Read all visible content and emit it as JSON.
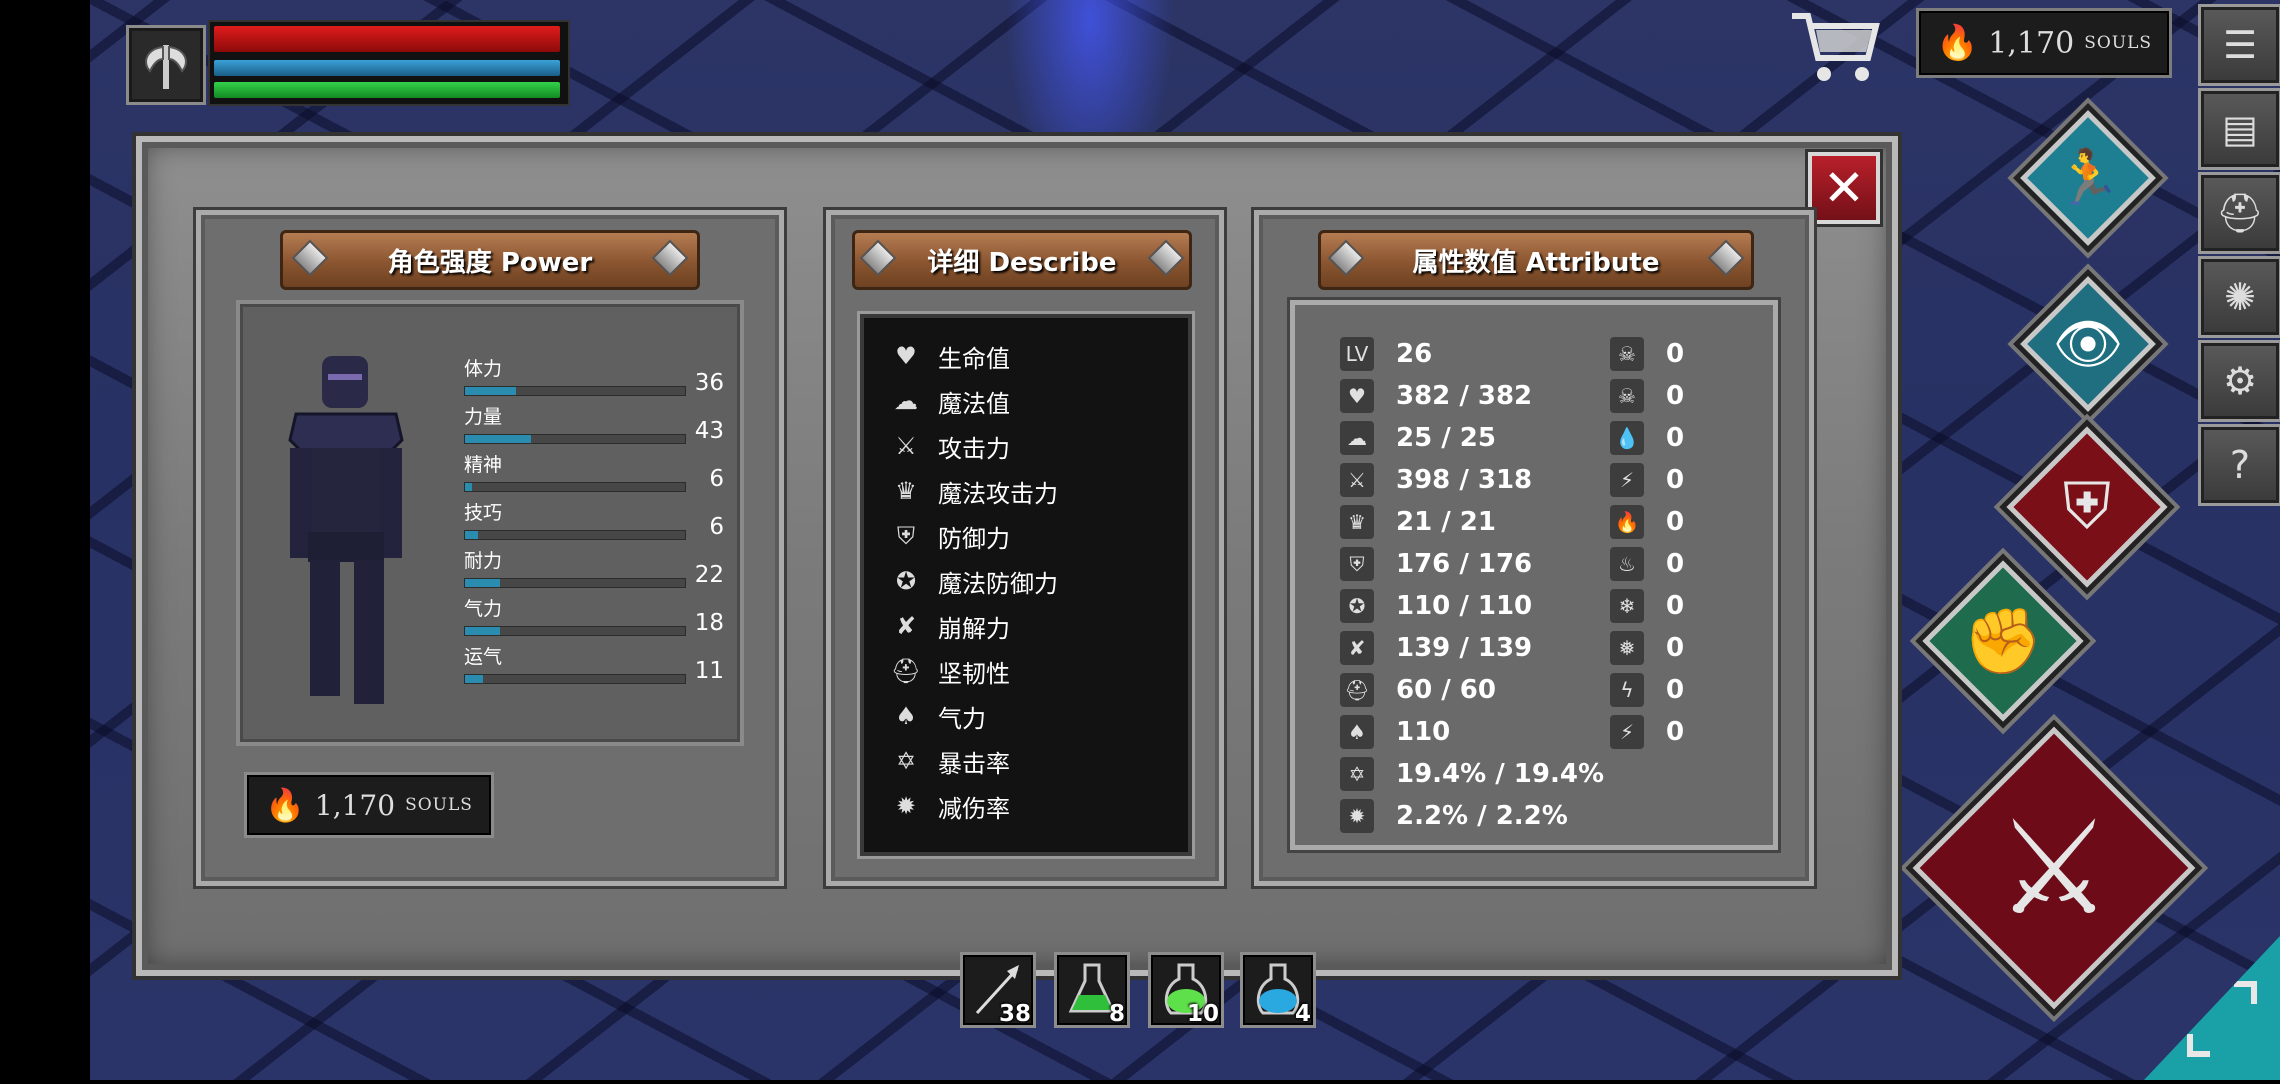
{
  "hud": {
    "weapon_icon": "axe-icon",
    "hp_fraction": 1.0,
    "mp_fraction": 1.0,
    "stamina_fraction": 1.0,
    "colors": {
      "hp": "#e01c1c",
      "mp": "#3aa2d8",
      "stamina": "#33d24a"
    }
  },
  "top_right": {
    "cart_icon": "shopping-cart-icon",
    "souls_amount": "1,170",
    "souls_unit": "SOULS",
    "side_menu": [
      {
        "icon": "list-menu-icon",
        "glyph": "☰"
      },
      {
        "icon": "scroll-icon",
        "glyph": "▤"
      },
      {
        "icon": "helmet-icon",
        "glyph": "⛑"
      },
      {
        "icon": "emblem-icon",
        "glyph": "✺"
      },
      {
        "icon": "settings-gear-icon",
        "glyph": "⚙"
      },
      {
        "icon": "help-icon",
        "glyph": "?"
      }
    ]
  },
  "skills": [
    {
      "name": "dodge-roll",
      "icon": "running-man-icon"
    },
    {
      "name": "look",
      "icon": "eye-icon"
    },
    {
      "name": "block",
      "icon": "shield-icon"
    },
    {
      "name": "grab",
      "icon": "fist-icon"
    },
    {
      "name": "attack",
      "icon": "crossed-swords-icon"
    }
  ],
  "panels": {
    "power": {
      "title": "角色强度 Power",
      "stats": [
        {
          "label": "体力",
          "value": "36",
          "fill": 0.23
        },
        {
          "label": "力量",
          "value": "43",
          "fill": 0.3
        },
        {
          "label": "精神",
          "value": "6",
          "fill": 0.03
        },
        {
          "label": "技巧",
          "value": "6",
          "fill": 0.06
        },
        {
          "label": "耐力",
          "value": "22",
          "fill": 0.16
        },
        {
          "label": "气力",
          "value": "18",
          "fill": 0.16
        },
        {
          "label": "运气",
          "value": "11",
          "fill": 0.08
        }
      ],
      "souls_amount": "1,170",
      "souls_unit": "SOULS"
    },
    "describe": {
      "title": "详细 Describe",
      "items": [
        {
          "label": "生命值",
          "icon": "heart-icon",
          "glyph": "♥"
        },
        {
          "label": "魔法值",
          "icon": "brain-icon",
          "glyph": "☁"
        },
        {
          "label": "攻击力",
          "icon": "sword-icon",
          "glyph": "⚔"
        },
        {
          "label": "魔法攻击力",
          "icon": "crown-icon",
          "glyph": "♛"
        },
        {
          "label": "防御力",
          "icon": "shield-icon",
          "glyph": "⛨"
        },
        {
          "label": "魔法防御力",
          "icon": "magic-shield-icon",
          "glyph": "✪"
        },
        {
          "label": "崩解力",
          "icon": "break-icon",
          "glyph": "✘"
        },
        {
          "label": "坚韧性",
          "icon": "helmet-icon",
          "glyph": "⛑"
        },
        {
          "label": "气力",
          "icon": "lungs-icon",
          "glyph": "♠"
        },
        {
          "label": "暴击率",
          "icon": "critical-star-icon",
          "glyph": "✡"
        },
        {
          "label": "减伤率",
          "icon": "reduction-shield-icon",
          "glyph": "✹"
        }
      ]
    },
    "attribute": {
      "title": "属性数值 Attribute",
      "left": [
        {
          "icon": "level-icon",
          "glyph": "LV",
          "value": "26"
        },
        {
          "icon": "heart-icon",
          "glyph": "♥",
          "value": "382 / 382"
        },
        {
          "icon": "brain-icon",
          "glyph": "☁",
          "value": "25 / 25"
        },
        {
          "icon": "sword-icon",
          "glyph": "⚔",
          "value": "398 / 318"
        },
        {
          "icon": "crown-icon",
          "glyph": "♛",
          "value": "21 / 21"
        },
        {
          "icon": "shield-icon",
          "glyph": "⛨",
          "value": "176 / 176"
        },
        {
          "icon": "magic-shield-icon",
          "glyph": "✪",
          "value": "110 / 110"
        },
        {
          "icon": "break-icon",
          "glyph": "✘",
          "value": "139 / 139"
        },
        {
          "icon": "helmet-icon",
          "glyph": "⛑",
          "value": "60 / 60"
        },
        {
          "icon": "lungs-icon",
          "glyph": "♠",
          "value": "110"
        },
        {
          "icon": "critical-star-icon",
          "glyph": "✡",
          "value": "19.4% / 19.4%"
        },
        {
          "icon": "reduction-shield-icon",
          "glyph": "✹",
          "value": "2.2% / 2.2%"
        }
      ],
      "right": [
        {
          "icon": "skull-icon",
          "glyph": "☠",
          "value": "0"
        },
        {
          "icon": "poison-skull-icon",
          "glyph": "☠",
          "value": "0"
        },
        {
          "icon": "blood-drop-icon",
          "glyph": "💧",
          "value": "0"
        },
        {
          "icon": "bleed-icon",
          "glyph": "⚡",
          "value": "0"
        },
        {
          "icon": "fire-icon",
          "glyph": "🔥",
          "value": "0"
        },
        {
          "icon": "fire-resist-icon",
          "glyph": "♨",
          "value": "0"
        },
        {
          "icon": "frost-icon",
          "glyph": "❄",
          "value": "0"
        },
        {
          "icon": "frost-resist-icon",
          "glyph": "❅",
          "value": "0"
        },
        {
          "icon": "lightning-icon",
          "glyph": "ϟ",
          "value": "0"
        },
        {
          "icon": "lightning-resist-icon",
          "glyph": "⚡",
          "value": "0"
        }
      ]
    }
  },
  "quickbar": [
    {
      "item": "arrow-icon",
      "count": "38"
    },
    {
      "item": "green-potion-icon",
      "count": "8",
      "color": "#2fbf3a"
    },
    {
      "item": "lime-potion-icon",
      "count": "10",
      "color": "#5ee04a"
    },
    {
      "item": "blue-potion-icon",
      "count": "4",
      "color": "#2aa8e0"
    }
  ],
  "corner": {
    "icon": "resize-corner-icon"
  }
}
